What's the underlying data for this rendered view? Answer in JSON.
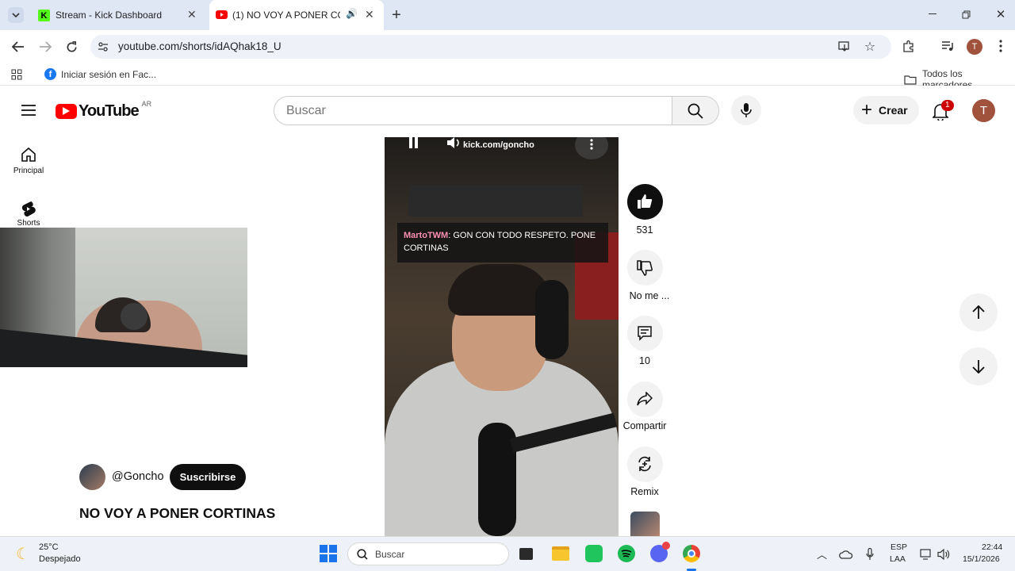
{
  "browser": {
    "tabs": [
      {
        "title": "Stream - Kick Dashboard",
        "active": false
      },
      {
        "title": "(1) NO VOY A PONER CORT",
        "active": true
      }
    ],
    "url": "youtube.com/shorts/idAQhak18_U",
    "bookmarks": [
      {
        "label": "Iniciar sesión en Fac..."
      }
    ],
    "all_bookmarks_label": "Todos los marcadores",
    "profile_initial": "T"
  },
  "youtube": {
    "logo_text": "YouTube",
    "region": "AR",
    "search_placeholder": "Buscar",
    "create_label": "Crear",
    "notification_count": "1",
    "avatar_initial": "T",
    "sidebar": [
      {
        "label": "Principal"
      },
      {
        "label": "Shorts"
      }
    ],
    "short": {
      "overlay_url": "kick.com/goncho",
      "chat_user": "MartoTWM",
      "chat_message": ": GON CON TODO RESPETO. PONE CORTINAS",
      "channel": "@Goncho",
      "subscribe_label": "Suscribirse",
      "title": "NO VOY A PONER CORTINAS"
    },
    "actions": {
      "likes": "531",
      "dislike_label": "No me ...",
      "comments": "10",
      "share_label": "Compartir",
      "remix_label": "Remix"
    }
  },
  "taskbar": {
    "temperature": "25°C",
    "weather": "Despejado",
    "search_placeholder": "Buscar",
    "lang_top": "ESP",
    "lang_bottom": "LAA",
    "time": "22:44",
    "date": "15/1/2026"
  },
  "colors": {
    "tabstrip": "#dfe7f5",
    "youtube_red": "#ff0000",
    "kick_green": "#53fc18",
    "avatar_brown": "#a0523c",
    "chat_user": "#ff8fb0"
  }
}
